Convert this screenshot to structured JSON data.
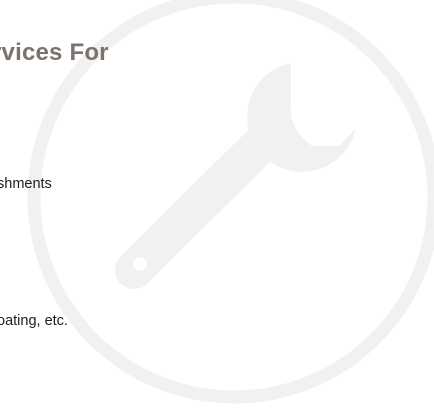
{
  "heading": "rvices For",
  "lines": [
    "shments",
    "oating, etc."
  ],
  "background_icon": "wrench-icon",
  "colors": {
    "heading": "#7d716c",
    "body_text": "#1e1e1e",
    "emblem": "#f3f1f0",
    "background": "#ffffff"
  }
}
